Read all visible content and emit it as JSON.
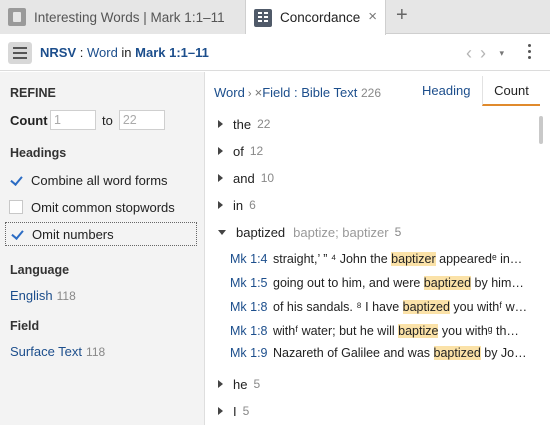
{
  "tabs": [
    {
      "label": "Interesting Words | Mark 1:1–11",
      "icon": "document-icon",
      "active": false
    },
    {
      "label": "Concordance",
      "icon": "concordance-icon",
      "active": true,
      "close": "×"
    }
  ],
  "add_tab": "+",
  "toolbar": {
    "version": "NRSV",
    "sep1": " : ",
    "field": "Word",
    "in_word": " in ",
    "passage": "Mark 1:1–11",
    "nav_back": "‹",
    "nav_forward": "›",
    "dropdown": "▾"
  },
  "refine": {
    "title": "REFINE",
    "count_label": "Count",
    "count_from_placeholder": "1",
    "count_to_label": "to",
    "count_to_placeholder": "22",
    "headings_title": "Headings",
    "options": [
      {
        "label": "Combine all word forms",
        "checked": true
      },
      {
        "label": "Omit common stopwords",
        "checked": false
      },
      {
        "label": "Omit numbers",
        "checked": true
      }
    ],
    "language_title": "Language",
    "language": {
      "label": "English",
      "count": "118"
    },
    "field_title": "Field",
    "field": {
      "label": "Surface Text",
      "count": "118"
    }
  },
  "results_header": {
    "crumb_word": "Word",
    "crumb_sep": " › ",
    "crumb_x": "×",
    "crumb_field": "Field : Bible Text",
    "crumb_count": "226",
    "toggle_heading": "Heading",
    "toggle_count": "Count"
  },
  "words": [
    {
      "word": "the",
      "count": "22"
    },
    {
      "word": "of",
      "count": "12"
    },
    {
      "word": "and",
      "count": "10"
    },
    {
      "word": "in",
      "count": "6"
    },
    {
      "word": "baptized",
      "forms": "baptize; baptizer",
      "count": "5",
      "expanded": true
    },
    {
      "word": "he",
      "count": "5"
    },
    {
      "word": "I",
      "count": "5"
    }
  ],
  "references": [
    {
      "ref": "Mk 1:4",
      "pre": "straight,’ ” ⁴ John the ",
      "hit": "baptizer",
      "post": " appearedᵉ in…"
    },
    {
      "ref": "Mk 1:5",
      "pre": "going out to him, and were ",
      "hit": "baptized",
      "post": " by him…"
    },
    {
      "ref": "Mk 1:8",
      "pre": "of his sandals. ⁸ I have ",
      "hit": "baptized",
      "post": " you withᶠ w…"
    },
    {
      "ref": "Mk 1:8",
      "pre": "withᶠ water; but he will ",
      "hit": "baptize",
      "post": " you withᵍ th…"
    },
    {
      "ref": "Mk 1:9",
      "pre": "Nazareth of Galilee and was ",
      "hit": "baptized",
      "post": " by Jo…"
    }
  ],
  "colors": {
    "link": "#1c4e8c",
    "highlight": "#fbe2a8",
    "accent": "#e08a2c"
  }
}
